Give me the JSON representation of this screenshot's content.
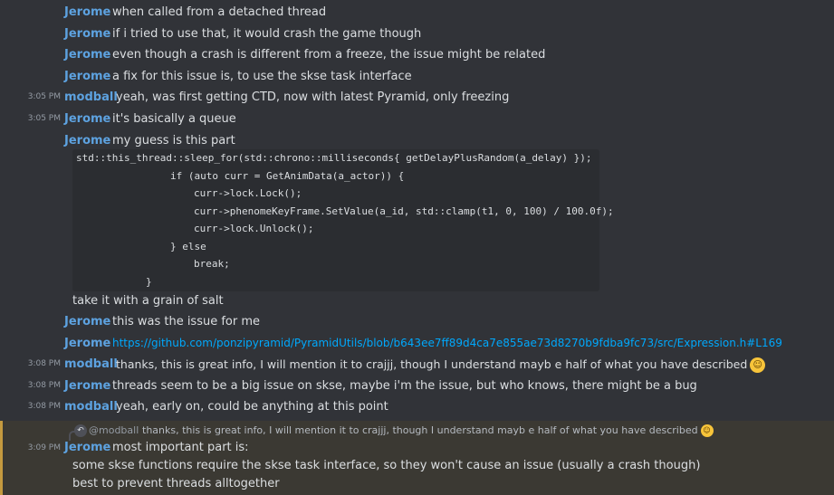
{
  "messages": [
    {
      "ts": "",
      "author": "Jerome",
      "text": "when called from a detached thread"
    },
    {
      "ts": "",
      "author": "Jerome",
      "text": "if i tried to use that, it would crash the game though"
    },
    {
      "ts": "",
      "author": "Jerome",
      "text": "even though a crash is different from a freeze, the issue might be related"
    },
    {
      "ts": "",
      "author": "Jerome",
      "text": "a fix for this issue is, to use the skse task interface"
    },
    {
      "ts": "3:05 PM",
      "author": "modball",
      "text": "yeah, was first getting CTD, now with latest Pyramid, only freezing"
    },
    {
      "ts": "3:05 PM",
      "author": "Jerome",
      "text": "it's basically a queue"
    },
    {
      "ts": "",
      "author": "Jerome",
      "text": "my guess is this part"
    }
  ],
  "code_lines": [
    "std::this_thread::sleep_for(std::chrono::milliseconds{ getDelayPlusRandom(a_delay) });",
    "if (auto curr = GetAnimData(a_actor)) {",
    "curr->lock.Lock();",
    "curr->phenomeKeyFrame.SetValue(a_id, std::clamp(t1, 0, 100) / 100.0f);",
    "curr->lock.Unlock();",
    "} else",
    "break;",
    "}"
  ],
  "after_code": "take it with a grain of salt",
  "messages2": [
    {
      "ts": "",
      "author": "Jerome",
      "text": "this was the issue for me"
    },
    {
      "ts": "",
      "author": "Jerome",
      "link": "https://github.com/ponzipyramid/PyramidUtils/blob/b643ee7ff89d4ca7e855ae73d8270b9fdba9fc73/src/Expression.h#L169"
    },
    {
      "ts": "3:08 PM",
      "author": "modball",
      "text": "thanks, this is great info, I will mention it to crajjj, though I understand mayb e half of what you have described",
      "emoji": "grinning-sweat-emoji"
    },
    {
      "ts": "3:08 PM",
      "author": "Jerome",
      "text": "threads seem to be a big issue on skse, maybe i'm the issue, but who knows, there might be a bug"
    },
    {
      "ts": "3:08 PM",
      "author": "modball",
      "text": "yeah, early on, could be anything at this point"
    }
  ],
  "reply": {
    "author": "@modball",
    "text": "thanks, this is great info, I will mention it to crajjj, though I understand mayb e half of what you have described",
    "emoji": "grinning-sweat-emoji"
  },
  "last_message": {
    "ts": "3:09 PM",
    "author": "Jerome",
    "lines": [
      "most important part is:",
      "some skse functions require the skse task interface, so they won't cause an issue (usually a crash though)",
      "best to prevent threads alltogether"
    ]
  },
  "colors": {
    "background": "#313338",
    "author": "#5da2e0",
    "link": "#00a8fc",
    "highlight": "#3b3933",
    "highlight_bar": "#c49a3f"
  }
}
